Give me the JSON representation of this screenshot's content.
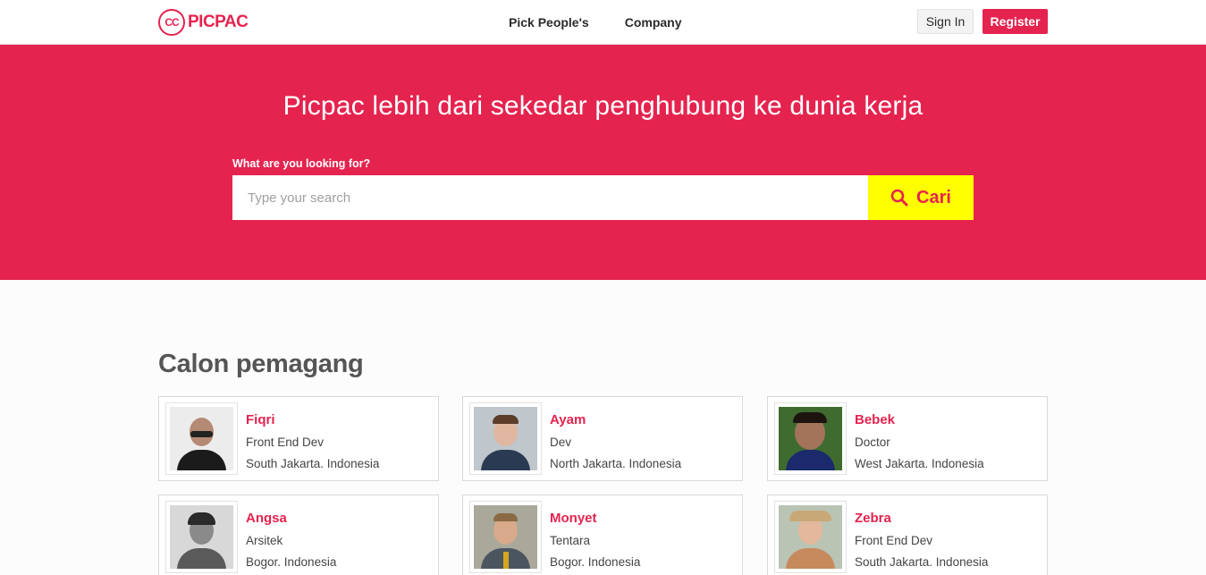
{
  "nav": {
    "logo_text": "PICPAC",
    "logo_mark": "CC",
    "links": [
      "Pick People's",
      "Company"
    ],
    "signin": "Sign In",
    "register": "Register"
  },
  "hero": {
    "title": "Picpac lebih dari sekedar penghubung ke dunia kerja",
    "search_label": "What are you looking for?",
    "search_placeholder": "Type your search",
    "search_button": "Cari"
  },
  "section": {
    "title": "Calon pemagang",
    "cards": [
      {
        "name": "Fiqri",
        "role": "Front End Dev",
        "location": "South Jakarta. Indonesia"
      },
      {
        "name": "Ayam",
        "role": "Dev",
        "location": "North Jakarta. Indonesia"
      },
      {
        "name": "Bebek",
        "role": "Doctor",
        "location": "West Jakarta. Indonesia"
      },
      {
        "name": "Angsa",
        "role": "Arsitek",
        "location": "Bogor. Indonesia"
      },
      {
        "name": "Monyet",
        "role": "Tentara",
        "location": "Bogor. Indonesia"
      },
      {
        "name": "Zebra",
        "role": "Front End Dev",
        "location": "South Jakarta. Indonesia"
      }
    ]
  },
  "colors": {
    "brand": "#e5234f",
    "search_button_bg": "#ffff00"
  }
}
